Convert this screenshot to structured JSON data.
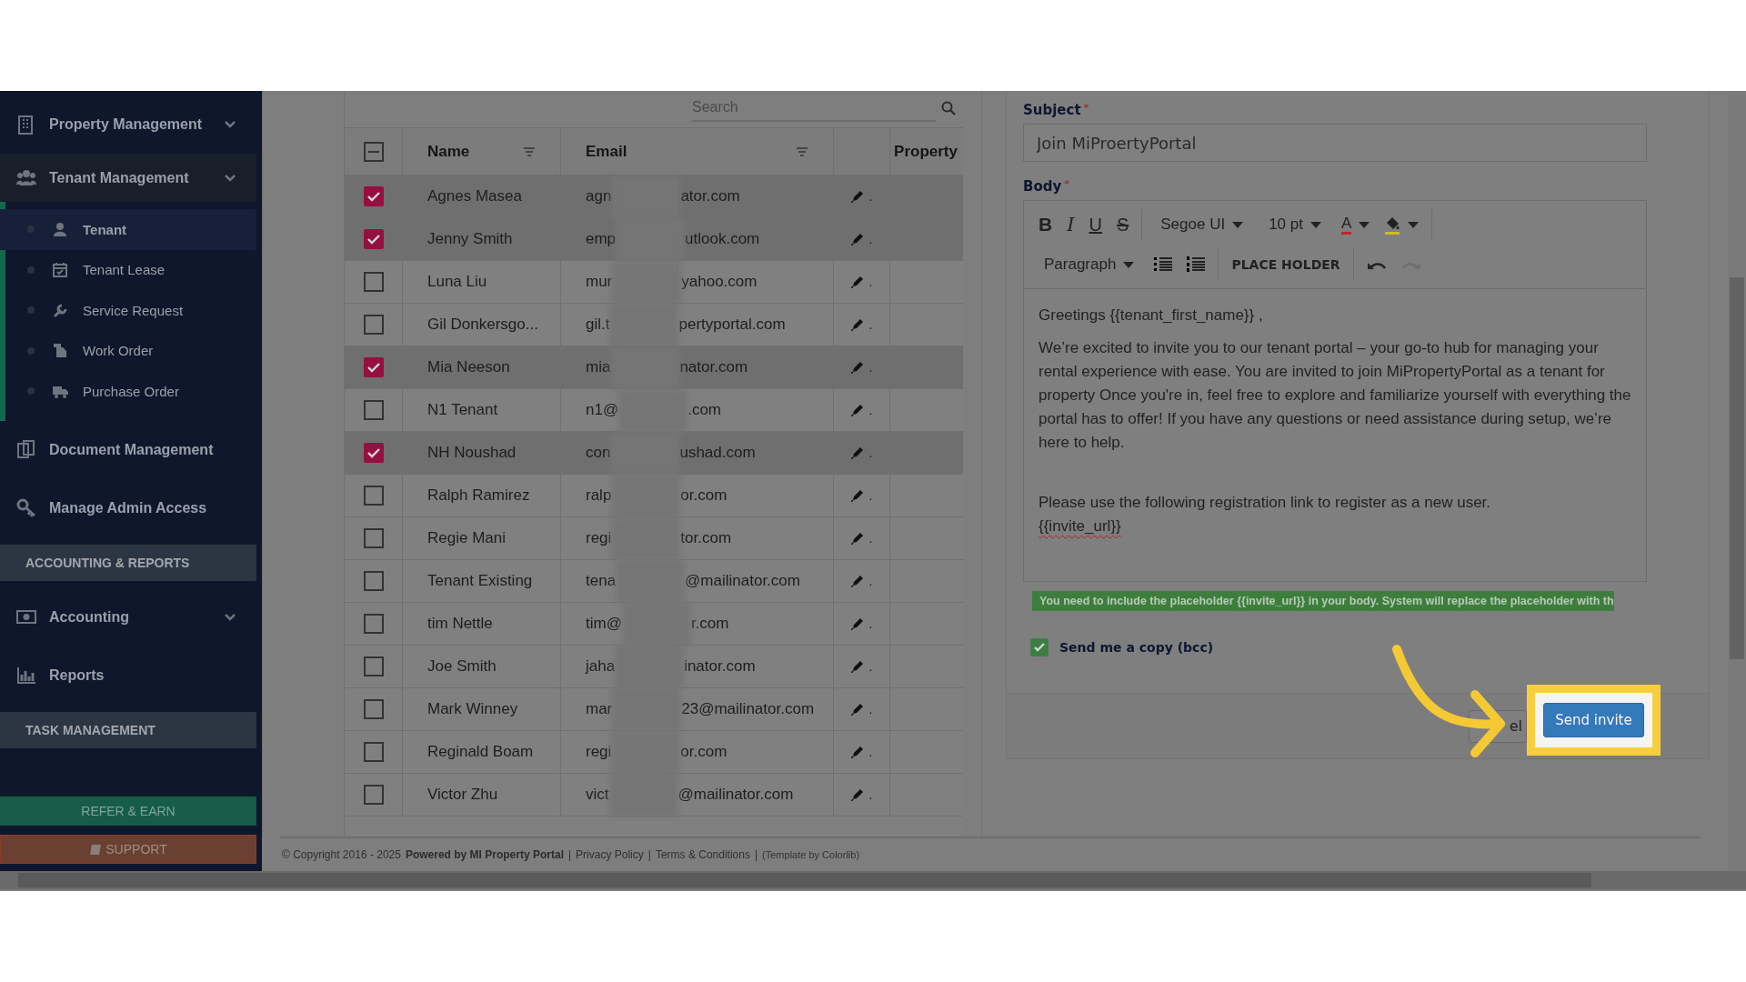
{
  "sidebar": {
    "items": [
      {
        "kind": "group",
        "label": "Property Management",
        "expanded": false
      },
      {
        "kind": "group",
        "label": "Tenant Management",
        "expanded": true,
        "children": [
          {
            "label": "Tenant",
            "selected": true
          },
          {
            "label": "Tenant Lease",
            "selected": false
          },
          {
            "label": "Service Request",
            "selected": false
          },
          {
            "label": "Work Order",
            "selected": false
          },
          {
            "label": "Purchase Order",
            "selected": false
          }
        ]
      },
      {
        "kind": "link",
        "label": "Document Management"
      },
      {
        "kind": "link",
        "label": "Manage Admin Access"
      },
      {
        "kind": "section",
        "label": "ACCOUNTING & REPORTS"
      },
      {
        "kind": "group",
        "label": "Accounting",
        "expanded": false
      },
      {
        "kind": "link",
        "label": "Reports"
      },
      {
        "kind": "section",
        "label": "TASK MANAGEMENT"
      }
    ],
    "buttons": [
      {
        "kind": "refer",
        "label": "REFER & EARN"
      },
      {
        "kind": "support",
        "label": "SUPPORT"
      }
    ]
  },
  "table": {
    "search": {
      "placeholder": "Search"
    },
    "select_all": {
      "checked": false,
      "indeterminate": true
    },
    "columns": [
      {
        "label": "Name",
        "filter": true
      },
      {
        "label": "Email",
        "filter": true
      },
      {
        "label": "Property",
        "filter": false
      }
    ],
    "rows": [
      {
        "selected": true,
        "name": "Agnes Masea",
        "email_start": "agn",
        "email_end": "ator.com",
        "action_mark": "."
      },
      {
        "selected": true,
        "name": "Jenny Smith",
        "email_start": "emp",
        "email_end": "utlook.com",
        "action_mark": "."
      },
      {
        "selected": false,
        "name": "Luna Liu",
        "email_start": "mur",
        "email_end": "yahoo.com",
        "action_mark": "."
      },
      {
        "selected": false,
        "name": "Gil Donkersgo...",
        "email_start": "gil.t",
        "email_end": "pertyportal.com",
        "action_mark": "."
      },
      {
        "selected": true,
        "name": "Mia Neeson",
        "email_start": "mia",
        "email_end": "nator.com",
        "action_mark": "."
      },
      {
        "selected": false,
        "name": "N1 Tenant",
        "email_start": "n1@",
        "email_end": ".com",
        "action_mark": "."
      },
      {
        "selected": true,
        "name": "NH Noushad",
        "email_start": "con",
        "email_end": "ushad.com",
        "action_mark": "."
      },
      {
        "selected": false,
        "name": "Ralph Ramirez",
        "email_start": "ralp",
        "email_end": "or.com",
        "action_mark": "."
      },
      {
        "selected": false,
        "name": "Regie Mani",
        "email_start": "regi",
        "email_end": "tor.com",
        "action_mark": "."
      },
      {
        "selected": false,
        "name": "Tenant Existing",
        "email_start": "tena",
        "email_end": "@mailinator.com",
        "action_mark": "."
      },
      {
        "selected": false,
        "name": "tim Nettle",
        "email_start": "tim@",
        "email_end": "r.com",
        "action_mark": "."
      },
      {
        "selected": false,
        "name": "Joe Smith",
        "email_start": "jaha",
        "email_end": "inator.com",
        "action_mark": "."
      },
      {
        "selected": false,
        "name": "Mark Winney",
        "email_start": "mar",
        "email_end": "23@mailinator.com",
        "action_mark": "."
      },
      {
        "selected": false,
        "name": "Reginald Boam",
        "email_start": "regi",
        "email_end": "or.com",
        "action_mark": "."
      },
      {
        "selected": false,
        "name": "Victor Zhu",
        "email_start": "vict",
        "email_end": "@mailinator.com",
        "action_mark": "."
      }
    ]
  },
  "invite": {
    "subject": {
      "label": "Subject",
      "required_mark": "*",
      "value": "Join MiProertyPortal"
    },
    "body": {
      "label": "Body",
      "required_mark": "*",
      "toolbar": [
        [
          {
            "kind": "bold",
            "label": "B"
          },
          {
            "kind": "italic",
            "label": "I"
          },
          {
            "kind": "underline",
            "label": "U"
          },
          {
            "kind": "strike",
            "label": "S"
          },
          {
            "kind": "sep"
          },
          {
            "kind": "dropdown",
            "label": "Segoe UI"
          },
          {
            "kind": "dropdown",
            "label": "10 pt"
          },
          {
            "kind": "color",
            "label": "A",
            "color": "#c0262b"
          },
          {
            "kind": "highlight",
            "color": "#c8c020"
          },
          {
            "kind": "sep"
          }
        ],
        [
          {
            "kind": "dropdown",
            "label": "Paragraph"
          },
          {
            "kind": "bullets"
          },
          {
            "kind": "numbers"
          },
          {
            "kind": "sep"
          },
          {
            "kind": "text",
            "label": "PLACE HOLDER"
          },
          {
            "kind": "sep"
          },
          {
            "kind": "undo",
            "disabled": false
          },
          {
            "kind": "redo",
            "disabled": true
          }
        ]
      ],
      "paragraphs": [
        {
          "lines": [
            {
              "text": "Greetings {{tenant_first_name}} ,",
              "misspelled": false
            }
          ]
        },
        {
          "lines": [
            {
              "text": "We’re excited to invite you to our tenant portal – your go-to hub for managing your rental experience with ease. You are invited to join MiPropertyPortal as a tenant for property Once you're in, feel free to explore and familiarize yourself with everything the portal has to offer! If you have any questions or need assistance during setup, we’re here to help.",
              "misspelled": false
            }
          ]
        },
        {
          "lines": [
            {
              "text": "Please use the following registration link to register as a new user.",
              "misspelled": false
            },
            {
              "text": "{{invite_url}}",
              "misspelled": true
            }
          ]
        }
      ]
    },
    "notice": "You need to include the placeholder {{invite_url}} in your body. System will replace the placeholder with th",
    "bcc": {
      "label": "Send me a copy (bcc)",
      "checked": true
    },
    "buttons": [
      {
        "kind": "cancel",
        "label": "el"
      },
      {
        "kind": "primary",
        "label": "Send invite"
      }
    ]
  },
  "footer": {
    "parts": [
      {
        "kind": "text",
        "text": "© Copyright 2016 - 2025"
      },
      {
        "kind": "strong",
        "text": "Powered by MI Property Portal"
      },
      {
        "kind": "sep",
        "text": "|"
      },
      {
        "kind": "link",
        "text": "Privacy Policy"
      },
      {
        "kind": "sep",
        "text": "|"
      },
      {
        "kind": "link",
        "text": "Terms & Conditions"
      },
      {
        "kind": "sep",
        "text": "|"
      },
      {
        "kind": "credit",
        "text": "(Template by Colorlib)"
      }
    ]
  }
}
